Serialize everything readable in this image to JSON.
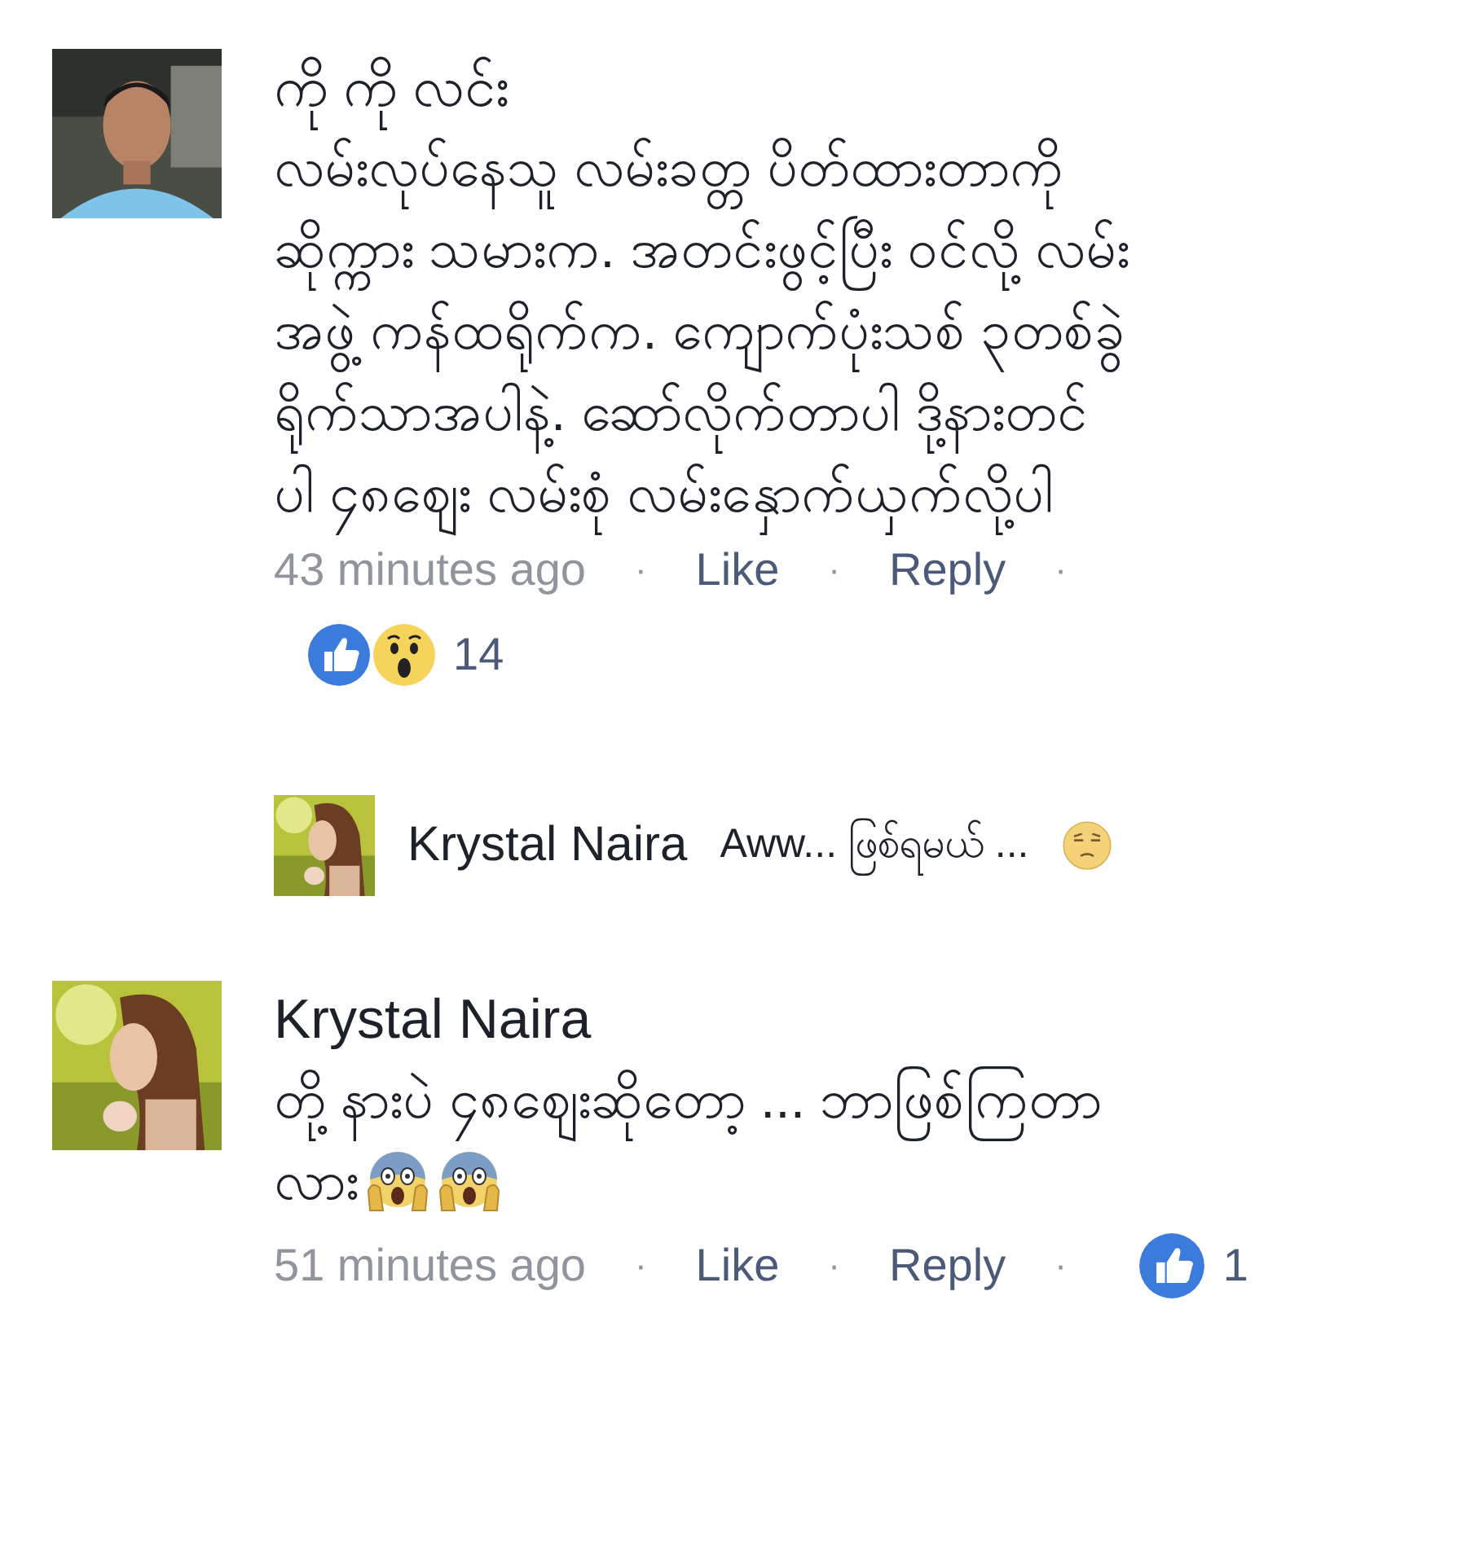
{
  "comments": [
    {
      "author": "ကို ကို လင်း",
      "lines": [
        "လမ်းလုပ်နေသူ လမ်းခတ္တ ပိတ်ထားတာကို",
        "ဆိုက္ကား သမားက. အတင်းဖွင့်ပြီး ဝင်လို့ လမ်း",
        "အဖွဲ့ ကန်ထရိုက်က. ကျောက်ပုံးသစ် ၃တစ်ခွဲ",
        "ရိုက်သာအပါနဲ့. ဆော်လိုက်တာပါ  ဒို့နားတင်",
        "ပါ ၄၈ဈေး လမ်းစုံ   လမ်းနှောက်ယှက်လို့ပါ"
      ],
      "time": "43 minutes ago",
      "separator": "·",
      "actions": [
        "Like",
        "Reply"
      ],
      "reactions": {
        "kind": "below",
        "icons": [
          {
            "kind": "like"
          },
          {
            "kind": "wow"
          }
        ],
        "count": "14"
      },
      "replies": [
        {
          "author": "Krystal Naira",
          "text": "Aww... ဖြစ်ရမယ် ...",
          "emoji": [
            {
              "kind": "unamused"
            }
          ]
        }
      ]
    },
    {
      "author": "Krystal Naira",
      "lines": [
        "တို့ နားပဲ ၄၈ဈေးဆိုတော့ ... ဘာဖြစ်ကြတာ",
        "လား"
      ],
      "emoji": [
        {
          "kind": "scream"
        },
        {
          "kind": "scream"
        }
      ],
      "time": "51 minutes ago",
      "separator": "·",
      "actions": [
        "Like",
        "Reply"
      ],
      "reactions": {
        "kind": "inline",
        "icons": [
          {
            "kind": "like"
          }
        ],
        "count": "1"
      }
    }
  ]
}
